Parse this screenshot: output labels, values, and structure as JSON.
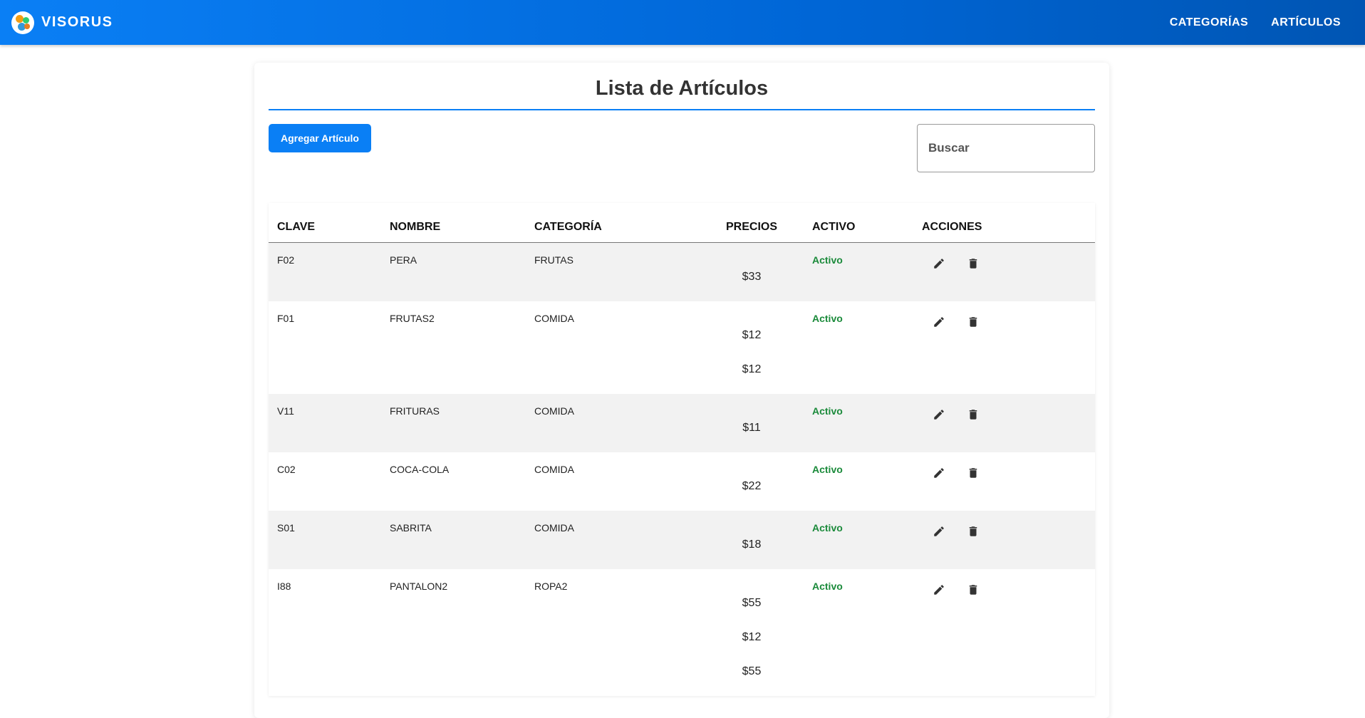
{
  "brand": {
    "name": "VISORUS"
  },
  "nav": {
    "categorias": "CATEGORÍAS",
    "articulos": "ARTÍCULOS"
  },
  "page": {
    "title": "Lista de Artículos",
    "add_button": "Agregar Artículo",
    "search_placeholder": "Buscar"
  },
  "table": {
    "headers": {
      "clave": "CLAVE",
      "nombre": "NOMBRE",
      "categoria": "CATEGORÍA",
      "precios": "PRECIOS",
      "activo": "ACTIVO",
      "acciones": "ACCIONES"
    },
    "rows": [
      {
        "clave": "F02",
        "nombre": "PERA",
        "categoria": "FRUTAS",
        "precios": [
          "$33"
        ],
        "activo": "Activo"
      },
      {
        "clave": "F01",
        "nombre": "FRUTAS2",
        "categoria": "COMIDA",
        "precios": [
          "$12",
          "$12"
        ],
        "activo": "Activo"
      },
      {
        "clave": "V11",
        "nombre": "FRITURAS",
        "categoria": "COMIDA",
        "precios": [
          "$11"
        ],
        "activo": "Activo"
      },
      {
        "clave": "C02",
        "nombre": "COCA-COLA",
        "categoria": "COMIDA",
        "precios": [
          "$22"
        ],
        "activo": "Activo"
      },
      {
        "clave": "S01",
        "nombre": "SABRITA",
        "categoria": "COMIDA",
        "precios": [
          "$18"
        ],
        "activo": "Activo"
      },
      {
        "clave": "I88",
        "nombre": "PANTALON2",
        "categoria": "ROPA2",
        "precios": [
          "$55",
          "$12",
          "$55"
        ],
        "activo": "Activo"
      }
    ]
  },
  "icons": {
    "edit": "pencil-icon",
    "delete": "trash-icon"
  },
  "colors": {
    "primary": "#0a7ff5",
    "active": "#1a8a3a",
    "row_alt": "#f2f2f2"
  }
}
